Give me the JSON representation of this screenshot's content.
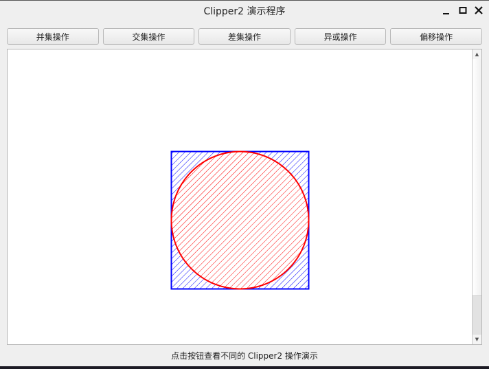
{
  "window": {
    "title": "Clipper2 演示程序"
  },
  "toolbar": {
    "buttons": [
      "并集操作",
      "交集操作",
      "差集操作",
      "异或操作",
      "偏移操作"
    ]
  },
  "status": "点击按钮查看不同的 Clipper2 操作演示",
  "colors": {
    "rect": "#0000ff",
    "circle": "#ff0000"
  }
}
